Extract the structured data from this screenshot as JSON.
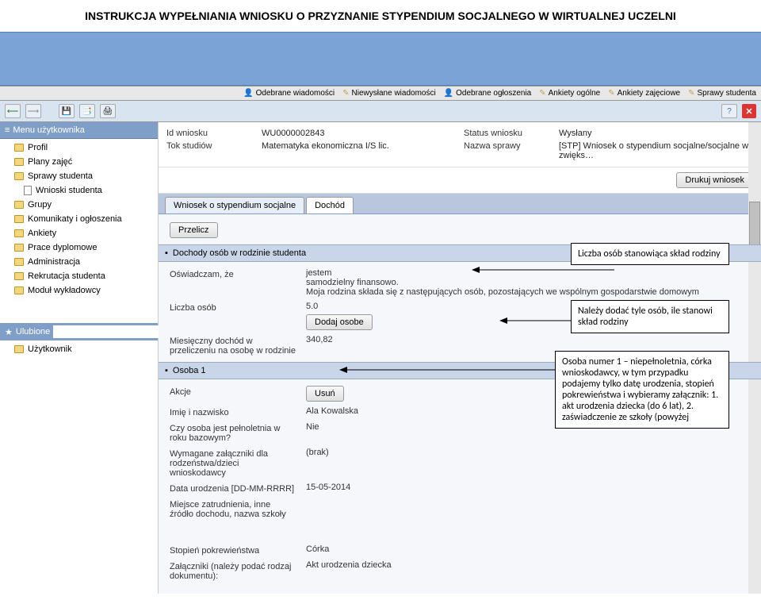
{
  "docTitle": "INSTRUKCJA WYPEŁNIANIA WNIOSKU O PRZYZNANIE STYPENDIUM SOCJALNEGO  W WIRTUALNEJ UCZELNI",
  "topbar": {
    "items": [
      "Odebrane wiadomości",
      "Niewysłane wiadomości",
      "Odebrane ogłoszenia",
      "Ankiety ogólne",
      "Ankiety zajęciowe",
      "Sprawy studenta"
    ]
  },
  "sidebar": {
    "menuHeader": "Menu użytkownika",
    "items": [
      "Profil",
      "Plany zajęć",
      "Sprawy studenta",
      "Wnioski studenta",
      "Grupy",
      "Komunikaty i ogłoszenia",
      "Ankiety",
      "Prace dyplomowe",
      "Administracja",
      "Rekrutacja studenta",
      "Moduł wykładowcy"
    ],
    "fav": "Ulubione",
    "user": "Użytkownik"
  },
  "info": {
    "idLabel": "Id wniosku",
    "idVal": "WU0000002843",
    "statusLabel": "Status wniosku",
    "statusVal": "Wysłany",
    "tokLabel": "Tok studiów",
    "tokVal": "Matematyka ekonomiczna I/S lic.",
    "nazwaLabel": "Nazwa sprawy",
    "nazwaVal": "[STP] Wniosek o stypendium socjalne/socjalne w zwięks…"
  },
  "printBtn": "Drukuj wniosek",
  "tabs": {
    "t1": "Wniosek o stypendium socjalne",
    "t2": "Dochód"
  },
  "przelicz": "Przelicz",
  "group1": "Dochody osób w rodzinie studenta",
  "osw": {
    "label": "Oświadczam, że",
    "ln1": "jestem",
    "ln2": "samodzielny finansowo.",
    "ln3": "Moja rodzina składa się z następujących osób, pozostających we wspólnym gospodarstwie domowym"
  },
  "liczba": {
    "label": "Liczba osób",
    "val": "5.0"
  },
  "dodaj": "Dodaj osobe",
  "mies": {
    "label": "Miesięczny dochód w przeliczeniu na osobę w rodzinie",
    "val": "340,82"
  },
  "osoba1": "Osoba 1",
  "akcje": {
    "label": "Akcje",
    "usun": "Usuń"
  },
  "imie": {
    "label": "Imię i nazwisko",
    "val": "Ala Kowalska"
  },
  "peln": {
    "label": "Czy osoba jest pełnoletnia w roku bazowym?",
    "val": "Nie"
  },
  "zal": {
    "label": "Wymagane załączniki dla rodzeństwa/dzieci wnioskodawcy",
    "val": "(brak)"
  },
  "datau": {
    "label": "Data urodzenia [DD-MM-RRRR]",
    "val": "15-05-2014"
  },
  "miejsce": {
    "label": "Miejsce zatrudnienia, inne źródło dochodu, nazwa szkoły"
  },
  "stop": {
    "label": "Stopień pokrewieństwa",
    "val": "Córka"
  },
  "zalacz": {
    "label": "Załączniki (należy podać rodzaj dokumentu):",
    "val": "Akt urodzenia dziecka"
  },
  "annot": {
    "a1": "Liczba osób stanowiąca skład rodziny",
    "a2": "Należy dodać tyle osób, ile stanowi skład rodziny",
    "a3": "Osoba numer 1 – niepełnoletnia, córka wnioskodawcy, w tym przypadku podajemy tylko datę urodzenia, stopień pokrewieństwa i wybieramy załącznik: 1. akt urodzenia dziecka (do 6 lat), 2. zaświadczenie ze szkoły (powyżej"
  }
}
